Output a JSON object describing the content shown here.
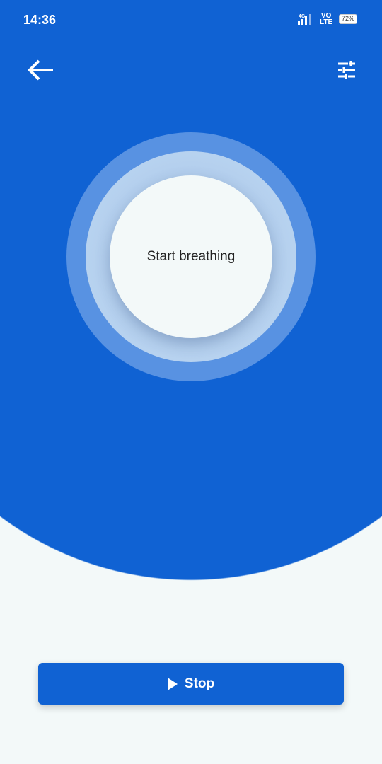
{
  "status_bar": {
    "time": "14:36",
    "network": "4G",
    "volte": [
      "VO",
      "LTE"
    ],
    "battery": "72%"
  },
  "header": {
    "back_icon": "arrow-left-icon",
    "settings_icon": "tune-icon"
  },
  "breathing": {
    "label": "Start breathing"
  },
  "action_button": {
    "label": "Stop",
    "icon": "play-icon"
  },
  "colors": {
    "primary": "#1062d3",
    "background": "#f3f9f9"
  }
}
